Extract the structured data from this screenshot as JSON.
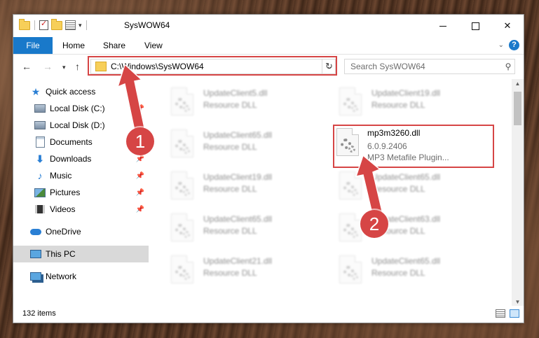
{
  "window": {
    "title": "SysWOW64"
  },
  "ribbon": {
    "file": "File",
    "home": "Home",
    "share": "Share",
    "view": "View",
    "help": "?"
  },
  "nav": {
    "address": "C:\\Windows\\SysWOW64",
    "search_placeholder": "Search SysWOW64"
  },
  "sidebar": {
    "items": [
      {
        "label": "Quick access",
        "icon": "star-icon"
      },
      {
        "label": "Local Disk (C:)",
        "icon": "disk-icon",
        "pinned": true
      },
      {
        "label": "Local Disk (D:)",
        "icon": "disk-icon",
        "pinned": true
      },
      {
        "label": "Documents",
        "icon": "documents-icon",
        "pinned": true
      },
      {
        "label": "Downloads",
        "icon": "download-icon",
        "pinned": true
      },
      {
        "label": "Music",
        "icon": "music-icon",
        "pinned": true
      },
      {
        "label": "Pictures",
        "icon": "pictures-icon",
        "pinned": true
      },
      {
        "label": "Videos",
        "icon": "videos-icon",
        "pinned": true
      },
      {
        "label": "OneDrive",
        "icon": "onedrive-icon"
      },
      {
        "label": "This PC",
        "icon": "pc-icon",
        "selected": true
      },
      {
        "label": "Network",
        "icon": "network-icon"
      }
    ]
  },
  "files": {
    "left": [
      {
        "name": "UpdateClient5.dll",
        "desc": "Resource DLL"
      },
      {
        "name": "UpdateClient65.dll",
        "desc": "Resource DLL"
      },
      {
        "name": "UpdateClient19.dll",
        "desc": "Resource DLL"
      },
      {
        "name": "UpdateClient65.dll",
        "desc": "Resource DLL"
      },
      {
        "name": "UpdateClient21.dll",
        "desc": "Resource DLL"
      }
    ],
    "right": [
      {
        "name": "UpdateClient19.dll",
        "desc": "Resource DLL"
      },
      {
        "name": "UpdateClient65.dll",
        "desc": "Resource DLL"
      },
      {
        "name": "UpdateClient63.dll",
        "desc": "Resource DLL"
      },
      {
        "name": "UpdateClient65.dll",
        "desc": "Resource DLL"
      }
    ],
    "selected": {
      "name": "mp3m3260.dll",
      "version": "6.0.9.2406",
      "desc": "MP3 Metafile Plugin..."
    }
  },
  "markers": {
    "one": "1",
    "two": "2"
  },
  "status": {
    "count": "132 items"
  },
  "colors": {
    "accent": "#1979ca",
    "highlight": "#d64545"
  }
}
